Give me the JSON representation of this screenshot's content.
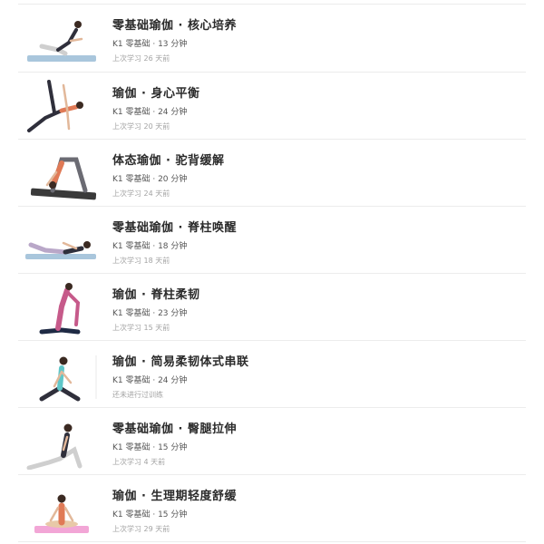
{
  "courses": [
    {
      "title": "零基础瑜伽 · 核心培养",
      "meta": "K1 零基础 · 13 分钟",
      "last": "上次学习 26 天前",
      "thumb_icon": "boat-pose-icon",
      "mat_color": "#a9c6dc"
    },
    {
      "title": "瑜伽 · 身心平衡",
      "meta": "K1 零基础 · 24 分钟",
      "last": "上次学习 20 天前",
      "thumb_icon": "side-plank-pose-icon",
      "mat_color": "none"
    },
    {
      "title": "体态瑜伽 · 驼背缓解",
      "meta": "K1 零基础 · 20 分钟",
      "last": "上次学习 24 天前",
      "thumb_icon": "forward-fold-pose-icon",
      "mat_color": "#3a3a3a"
    },
    {
      "title": "零基础瑜伽 · 脊柱唤醒",
      "meta": "K1 零基础 · 18 分钟",
      "last": "上次学习 18 天前",
      "thumb_icon": "locust-pose-icon",
      "mat_color": "#a9c6dc"
    },
    {
      "title": "瑜伽 · 脊柱柔韧",
      "meta": "K1 零基础 · 23 分钟",
      "last": "上次学习 15 天前",
      "thumb_icon": "king-pigeon-pose-icon",
      "mat_color": "none"
    },
    {
      "title": "瑜伽 · 简易柔韧体式串联",
      "meta": "K1 零基础 · 24 分钟",
      "last": "还未进行过训练",
      "thumb_icon": "seated-twist-pose-icon",
      "mat_color": "none"
    },
    {
      "title": "零基础瑜伽 · 臀腿拉伸",
      "meta": "K1 零基础 · 15 分钟",
      "last": "上次学习 4 天前",
      "thumb_icon": "lunge-pose-icon",
      "mat_color": "none"
    },
    {
      "title": "瑜伽 · 生理期轻度舒缓",
      "meta": "K1 零基础 · 15 分钟",
      "last": "上次学习 29 天前",
      "thumb_icon": "lotus-pose-icon",
      "mat_color": "#f2a6d6"
    }
  ]
}
